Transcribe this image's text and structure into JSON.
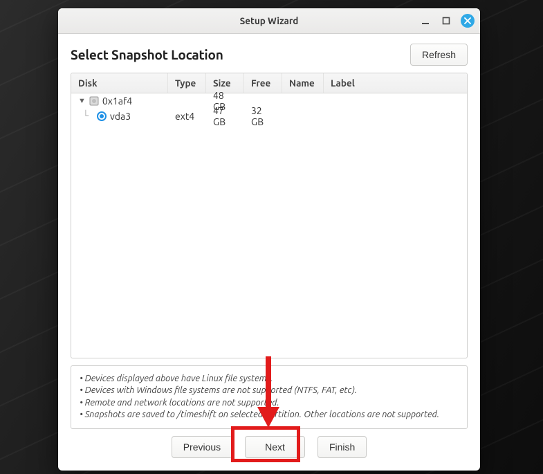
{
  "window": {
    "title": "Setup Wizard"
  },
  "page": {
    "heading": "Select Snapshot Location",
    "refresh_label": "Refresh"
  },
  "columns": {
    "disk": "Disk",
    "type": "Type",
    "size": "Size",
    "free": "Free",
    "name": "Name",
    "label": "Label"
  },
  "tree": {
    "parent": {
      "disk": "0x1af4",
      "type": "",
      "size": "48 GB",
      "free": "",
      "name": "",
      "label": ""
    },
    "child": {
      "disk": "vda3",
      "type": "ext4",
      "size": "47 GB",
      "free": "32 GB",
      "name": "",
      "label": ""
    }
  },
  "notes": {
    "l1": "Devices displayed above have Linux file systems.",
    "l2": "Devices with Windows file systems are not supported (NTFS, FAT, etc).",
    "l3": "Remote and network locations are not supported.",
    "l4": "Snapshots are saved to /timeshift on selected partition. Other locations are not supported."
  },
  "footer": {
    "previous": "Previous",
    "next": "Next",
    "finish": "Finish"
  }
}
